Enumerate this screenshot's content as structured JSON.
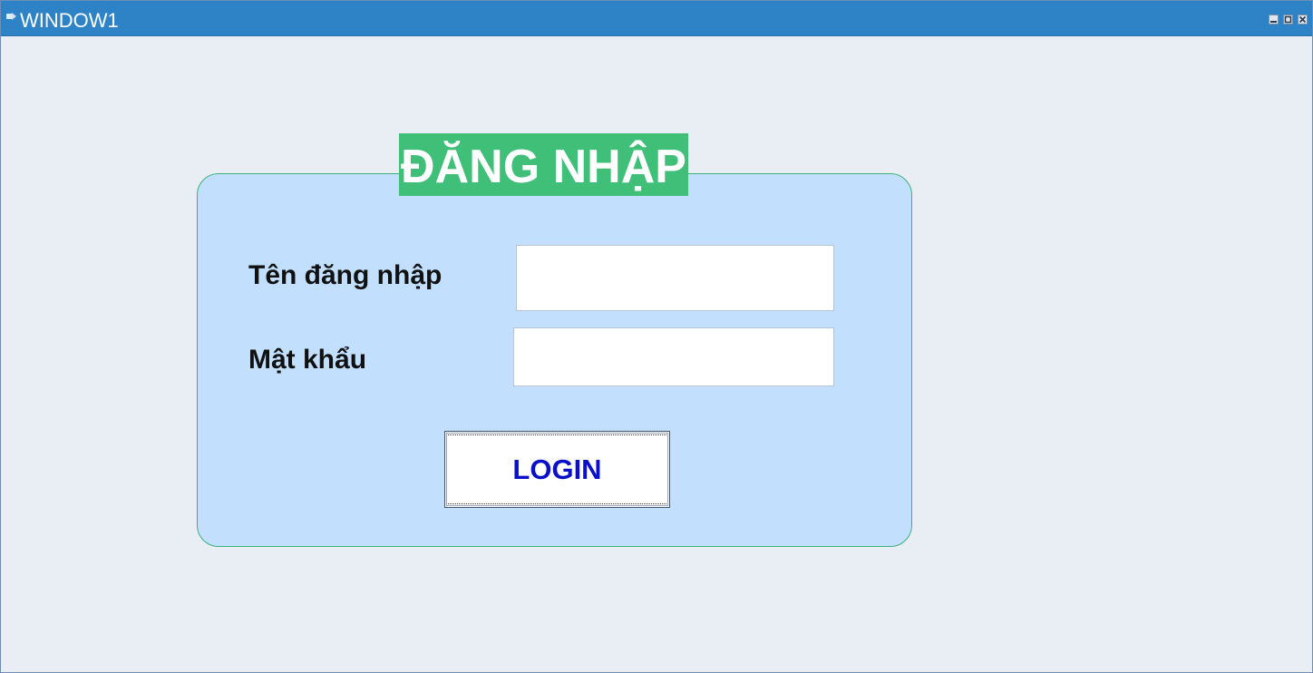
{
  "window": {
    "title": "WINDOW1",
    "icon": "app-icon",
    "controls": [
      "minimize-icon",
      "maximize-icon",
      "close-icon"
    ]
  },
  "login_form": {
    "heading": "ĐĂNG NHẬP",
    "username_label": "Tên đăng nhập",
    "username_value": "",
    "password_label": "Mật khẩu",
    "password_value": "",
    "submit_label": "LOGIN"
  },
  "colors": {
    "titlebar": "#2e83c6",
    "window_background": "#e9eef5",
    "panel_background": "#c2e0fd",
    "panel_border": "#3fb17a",
    "heading_background": "#40bf79",
    "heading_text": "#ffffff",
    "button_text": "#0a10c8"
  }
}
